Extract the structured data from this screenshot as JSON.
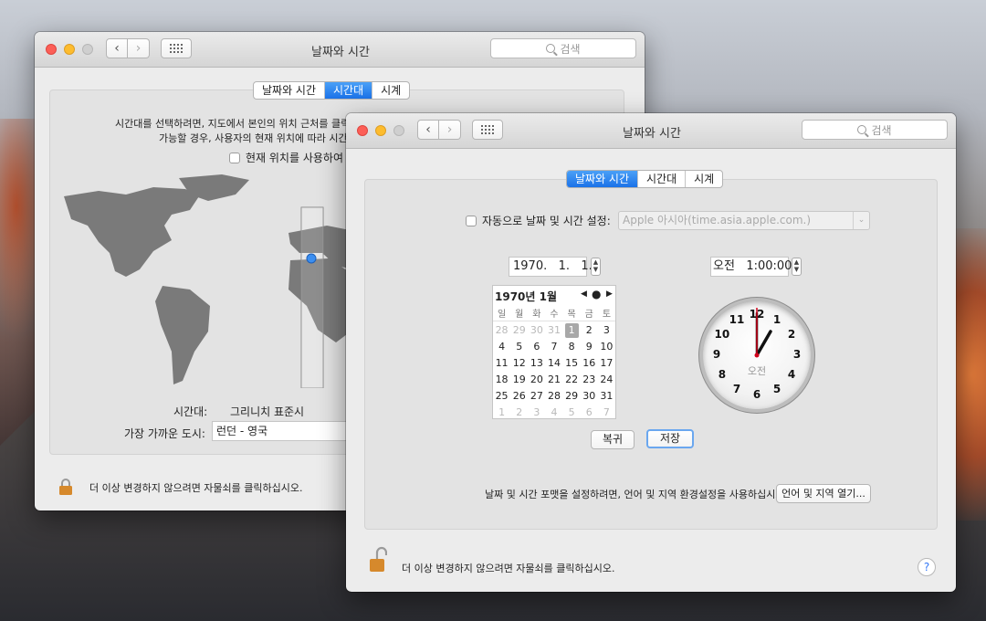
{
  "back_window": {
    "title": "날짜와 시간",
    "search_placeholder": "검색",
    "tabs": [
      {
        "label": "날짜와 시간",
        "selected": false
      },
      {
        "label": "시간대",
        "selected": true
      },
      {
        "label": "시계",
        "selected": false
      }
    ],
    "instruction_line1": "시간대를 선택하려면, 지도에서 본인의 위치 근처를 클릭한",
    "instruction_line2": "가능할 경우, 사용자의 현재 위치에 따라 시간대를",
    "use_location_label": "현재 위치를 사용하여",
    "timezone_label": "시간대:",
    "timezone_value": "그리니치 표준시",
    "closest_city_label": "가장 가까운 도시:",
    "closest_city_value": "런던 - 영국",
    "lock_text": "더 이상 변경하지 않으려면 자물쇠를 클릭하십시오."
  },
  "front_window": {
    "title": "날짜와 시간",
    "search_placeholder": "검색",
    "tabs": [
      {
        "label": "날짜와 시간",
        "selected": true
      },
      {
        "label": "시간대",
        "selected": false
      },
      {
        "label": "시계",
        "selected": false
      }
    ],
    "auto_set_label": "자동으로 날짜 및 시간 설정:",
    "auto_set_checked": false,
    "time_server": "Apple 아시아(time.asia.apple.com.)",
    "date_field": "1970.   1.   1.",
    "time_field": "오전   1:00:00",
    "calendar": {
      "month_title": "1970년 1월",
      "weekdays": [
        "일",
        "월",
        "화",
        "수",
        "목",
        "금",
        "토"
      ],
      "days": [
        "28",
        "29",
        "30",
        "31",
        "1",
        "2",
        "3",
        "4",
        "5",
        "6",
        "7",
        "8",
        "9",
        "10",
        "11",
        "12",
        "13",
        "14",
        "15",
        "16",
        "17",
        "18",
        "19",
        "20",
        "21",
        "22",
        "23",
        "24",
        "25",
        "26",
        "27",
        "28",
        "29",
        "30",
        "31",
        "1",
        "2",
        "3",
        "4",
        "5",
        "6",
        "7"
      ],
      "selected_day": "1"
    },
    "clock": {
      "ampm": "오전",
      "numbers": [
        "12",
        "1",
        "2",
        "3",
        "4",
        "5",
        "6",
        "7",
        "8",
        "9",
        "10",
        "11"
      ],
      "hour": 1,
      "minute": 0,
      "second": 0
    },
    "revert_button": "복귀",
    "save_button": "저장",
    "format_text": "날짜 및 시간 포맷을 설정하려면, 언어 및 지역 환경설정을 사용하십시오.",
    "open_language_button": "언어 및 지역 열기...",
    "lock_text": "더 이상 변경하지 않으려면 자물쇠를 클릭하십시오.",
    "help_label": "?"
  },
  "colors": {
    "accent": "#1b72e8",
    "second_hand": "#d0021b",
    "lock": "#d6892c"
  }
}
